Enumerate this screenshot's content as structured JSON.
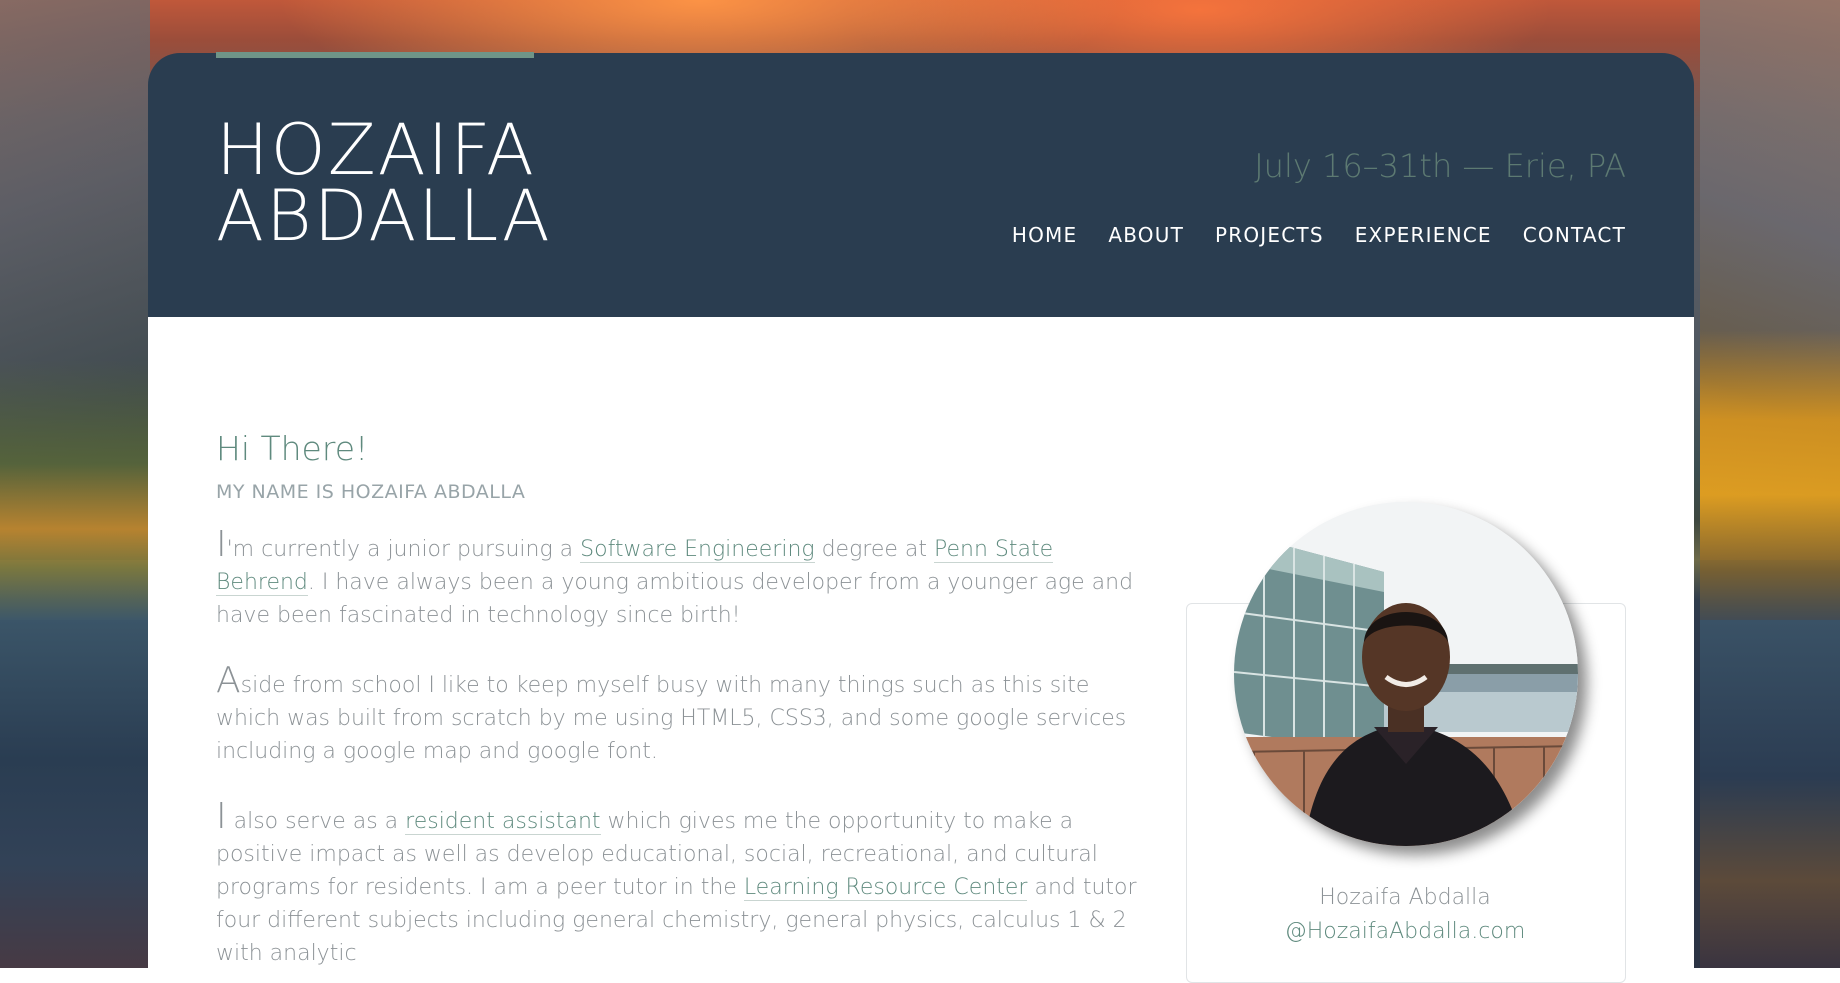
{
  "header": {
    "brand_line1": "HOZAIFA",
    "brand_line2": "ABDALLA",
    "event_date": "July 16–31th — Erie, PA",
    "nav": [
      {
        "label": "HOME"
      },
      {
        "label": "ABOUT"
      },
      {
        "label": "PROJECTS"
      },
      {
        "label": "EXPERIENCE"
      },
      {
        "label": "CONTACT"
      }
    ]
  },
  "intro": {
    "greeting": "Hi There!",
    "subhead": "MY NAME IS HOZAIFA ABDALLA",
    "p1": {
      "dropcap": "I",
      "text_a": "'m currently a junior pursuing a ",
      "link1": "Software Engineering",
      "text_b": " degree at ",
      "link2": "Penn State Behrend",
      "text_c": ". I have always been a young ambitious developer from a younger age and have been fascinated in technology since birth!"
    },
    "p2": {
      "dropcap": "A",
      "text": "side from school I like to keep myself busy with many things such as this site which was built from scratch by me using HTML5, CSS3, and some google services including a google map and google font."
    },
    "p3": {
      "dropcap": "I",
      "text_a": " also serve as a ",
      "link1": "resident assistant",
      "text_b": " which gives me the opportunity to make a positive impact as well as develop educational, social, recreational, and cultural programs for residents. I am a peer tutor in the ",
      "link2": "Learning Resource Center",
      "text_c": " and tutor four different subjects including general chemistry, general physics, calculus 1 & 2 with analytic"
    }
  },
  "profile": {
    "name": "Hozaifa Abdalla",
    "handle": "@HozaifaAbdalla.com"
  },
  "colors": {
    "header_bg": "#2a3d50",
    "accent": "#6f9588",
    "link": "#5f8a7e",
    "body_text": "#8c9296"
  }
}
